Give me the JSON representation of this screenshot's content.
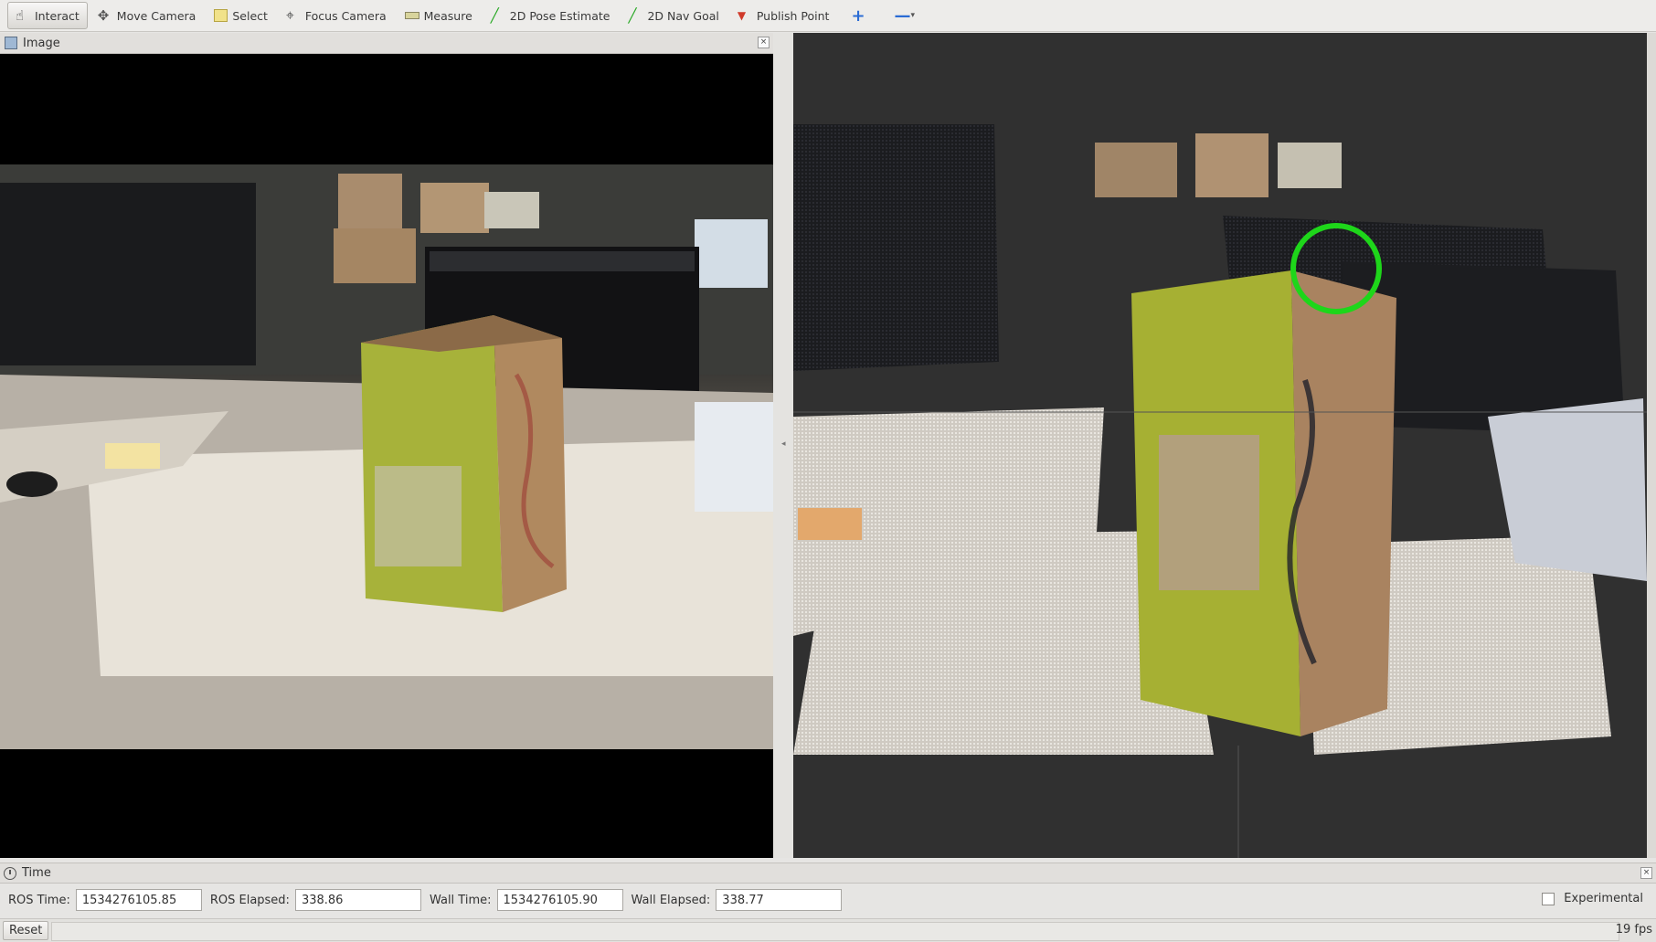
{
  "toolbar": {
    "tools": [
      {
        "label": "Interact",
        "icon": "hand-icon"
      },
      {
        "label": "Move Camera",
        "icon": "move-camera-icon"
      },
      {
        "label": "Select",
        "icon": "select-icon"
      },
      {
        "label": "Focus Camera",
        "icon": "focus-camera-icon"
      },
      {
        "label": "Measure",
        "icon": "measure-icon"
      },
      {
        "label": "2D Pose Estimate",
        "icon": "green-arrow-icon"
      },
      {
        "label": "2D Nav Goal",
        "icon": "green-arrow-icon"
      },
      {
        "label": "Publish Point",
        "icon": "map-pin-icon"
      }
    ],
    "add_symbol": "+",
    "remove_symbol": "—",
    "dropdown_symbol": "▾"
  },
  "image_panel": {
    "title": "Image",
    "close_symbol": "×"
  },
  "time_panel": {
    "title": "Time",
    "ros_time_label": "ROS Time:",
    "ros_time_value": "1534276105.85",
    "ros_elapsed_label": "ROS Elapsed:",
    "ros_elapsed_value": "338.86",
    "wall_time_label": "Wall Time:",
    "wall_time_value": "1534276105.90",
    "wall_elapsed_label": "Wall Elapsed:",
    "wall_elapsed_value": "338.77",
    "experimental_label": "Experimental"
  },
  "status": {
    "reset_label": "Reset",
    "fps": "19 fps"
  },
  "colors": {
    "accent_green": "#1ed61a",
    "bag_green": "#a8b43a",
    "bag_brown": "#a8835c",
    "view_bg": "#303030"
  }
}
